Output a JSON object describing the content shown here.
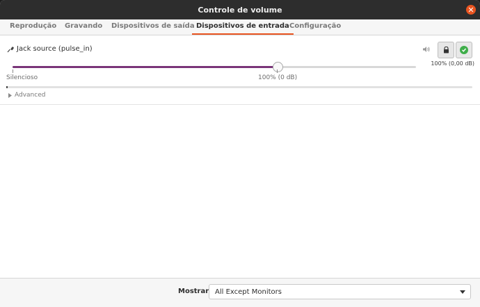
{
  "window": {
    "title": "Controle de volume"
  },
  "tabs": [
    {
      "label": "Reprodução"
    },
    {
      "label": "Gravando"
    },
    {
      "label": "Dispositivos de saída"
    },
    {
      "label": "Dispositivos de entrada",
      "active": true
    },
    {
      "label": "Configuração"
    }
  ],
  "device": {
    "name": "Jack source (pulse_in)",
    "volume_readout": "100% (0,00 dB)",
    "slider_value_percent": 100,
    "slider_left_label": "Silencioso",
    "slider_mid_label": "100% (0 dB)",
    "meter_level_percent": 0,
    "advanced_label": "Advanced",
    "icons": [
      "microphone-icon",
      "speaker-icon",
      "lock-icon",
      "check-icon"
    ]
  },
  "footer": {
    "label": "Mostrar:",
    "select_value": "All Except Monitors"
  },
  "colors": {
    "accent": "#e95420",
    "slider_fill": "#7a3579",
    "titlebar": "#2d2d2d",
    "check": "#3fae4a"
  }
}
